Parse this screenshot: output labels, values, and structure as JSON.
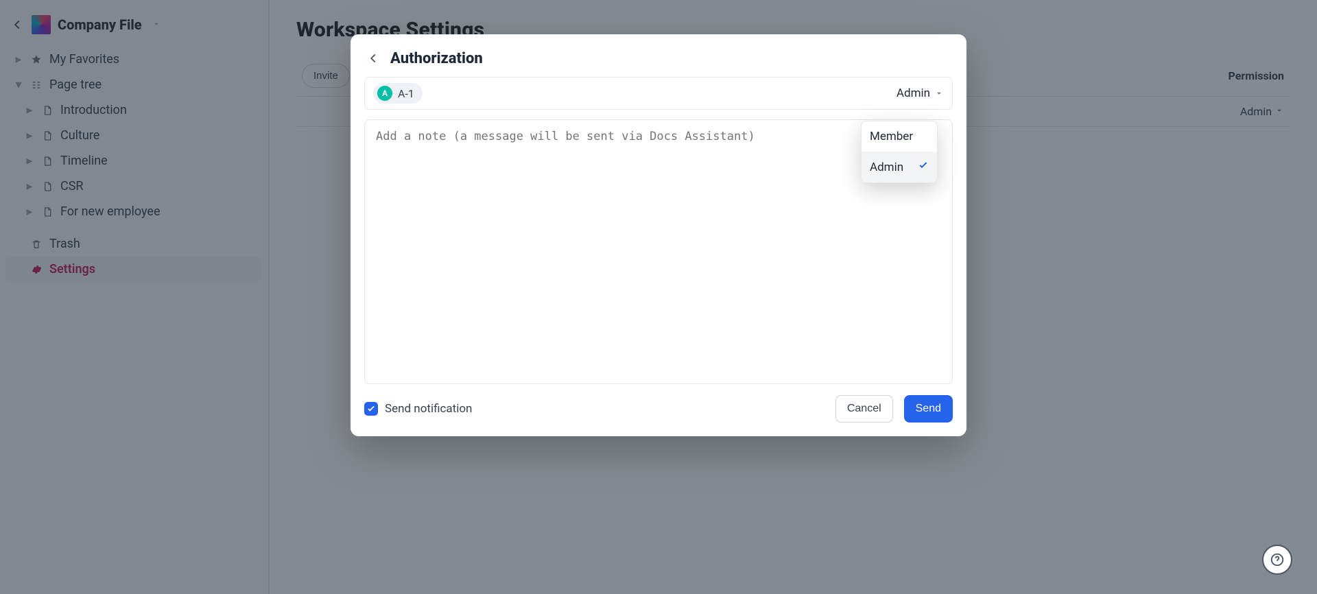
{
  "workspace": {
    "title": "Company File",
    "nav": {
      "favorites": "My Favorites",
      "page_tree": "Page tree",
      "items": [
        {
          "label": "Introduction"
        },
        {
          "label": "Culture"
        },
        {
          "label": "Timeline"
        },
        {
          "label": "CSR"
        },
        {
          "label": "For new employee"
        }
      ],
      "trash": "Trash",
      "settings": "Settings"
    }
  },
  "page": {
    "title": "Workspace Settings",
    "permission_header": "Permission",
    "permission_value": "Admin",
    "invite_button": "Invite"
  },
  "modal": {
    "title": "Authorization",
    "chip": {
      "avatar_initial": "A",
      "label": "A-1"
    },
    "role": {
      "selected": "Admin",
      "options": [
        "Member",
        "Admin"
      ],
      "selected_index": 1
    },
    "note_placeholder": "Add a note (a message will be sent via Docs Assistant)",
    "send_notification_label": "Send notification",
    "send_notification_checked": true,
    "cancel": "Cancel",
    "send": "Send"
  },
  "help": {
    "title": "Help"
  }
}
